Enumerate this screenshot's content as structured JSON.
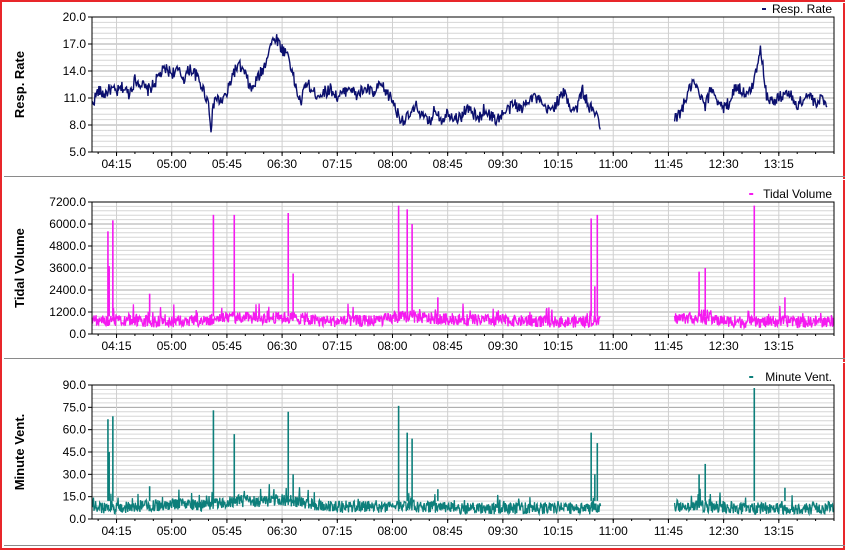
{
  "chart_data": [
    {
      "type": "line",
      "ylabel": "Resp. Rate",
      "legend": "Resp. Rate",
      "legend_position": "top-right",
      "color": "#0b0f6e",
      "ylim": [
        5.0,
        20.0
      ],
      "yticks": [
        "5.0",
        "8.0",
        "11.0",
        "14.0",
        "17.0",
        "20.0"
      ],
      "grid": true,
      "xlim": [
        "03:55",
        "14:00"
      ],
      "xticks": [
        "04:15",
        "05:00",
        "05:45",
        "06:30",
        "07:15",
        "08:00",
        "08:45",
        "09:30",
        "10:15",
        "11:00",
        "11:45",
        "12:30",
        "13:15"
      ],
      "gap": [
        "10:50",
        "11:50"
      ],
      "series": [
        {
          "values": [
            [
              "03:55",
              10.3
            ],
            [
              "04:00",
              11.8
            ],
            [
              "04:05",
              11.4
            ],
            [
              "04:10",
              12.0
            ],
            [
              "04:15",
              11.6
            ],
            [
              "04:20",
              12.2
            ],
            [
              "04:25",
              11.5
            ],
            [
              "04:30",
              13.0
            ],
            [
              "04:35",
              12.6
            ],
            [
              "04:40",
              11.8
            ],
            [
              "04:45",
              12.4
            ],
            [
              "04:50",
              13.6
            ],
            [
              "04:55",
              14.2
            ],
            [
              "05:00",
              13.8
            ],
            [
              "05:05",
              14.0
            ],
            [
              "05:10",
              13.2
            ],
            [
              "05:15",
              14.3
            ],
            [
              "05:20",
              13.5
            ],
            [
              "05:25",
              12.2
            ],
            [
              "05:30",
              10.5
            ],
            [
              "05:32",
              7.8
            ],
            [
              "05:35",
              11.0
            ],
            [
              "05:40",
              10.6
            ],
            [
              "05:45",
              11.4
            ],
            [
              "05:50",
              13.8
            ],
            [
              "05:55",
              14.6
            ],
            [
              "06:00",
              13.6
            ],
            [
              "06:05",
              11.8
            ],
            [
              "06:10",
              13.2
            ],
            [
              "06:15",
              14.3
            ],
            [
              "06:20",
              16.8
            ],
            [
              "06:25",
              17.8
            ],
            [
              "06:30",
              16.4
            ],
            [
              "06:35",
              15.9
            ],
            [
              "06:40",
              12.8
            ],
            [
              "06:45",
              10.4
            ],
            [
              "06:50",
              12.8
            ],
            [
              "06:55",
              11.6
            ],
            [
              "07:00",
              11.4
            ],
            [
              "07:05",
              11.7
            ],
            [
              "07:10",
              12.0
            ],
            [
              "07:15",
              11.1
            ],
            [
              "07:20",
              11.5
            ],
            [
              "07:25",
              12.4
            ],
            [
              "07:30",
              11.2
            ],
            [
              "07:35",
              11.8
            ],
            [
              "07:40",
              12.0
            ],
            [
              "07:45",
              11.4
            ],
            [
              "07:50",
              12.5
            ],
            [
              "07:55",
              11.6
            ],
            [
              "08:00",
              10.8
            ],
            [
              "08:05",
              9.0
            ],
            [
              "08:10",
              8.5
            ],
            [
              "08:15",
              9.2
            ],
            [
              "08:20",
              10.1
            ],
            [
              "08:25",
              8.8
            ],
            [
              "08:30",
              8.3
            ],
            [
              "08:35",
              9.8
            ],
            [
              "08:40",
              8.6
            ],
            [
              "08:45",
              9.4
            ],
            [
              "08:50",
              9.0
            ],
            [
              "08:55",
              8.7
            ],
            [
              "09:00",
              9.9
            ],
            [
              "09:05",
              9.4
            ],
            [
              "09:10",
              8.6
            ],
            [
              "09:15",
              9.8
            ],
            [
              "09:20",
              9.0
            ],
            [
              "09:25",
              8.6
            ],
            [
              "09:30",
              9.2
            ],
            [
              "09:35",
              9.8
            ],
            [
              "09:40",
              10.4
            ],
            [
              "09:45",
              9.6
            ],
            [
              "09:50",
              10.9
            ],
            [
              "09:55",
              11.2
            ],
            [
              "10:00",
              10.6
            ],
            [
              "10:05",
              9.6
            ],
            [
              "10:10",
              9.8
            ],
            [
              "10:15",
              10.7
            ],
            [
              "10:20",
              11.6
            ],
            [
              "10:25",
              10.0
            ],
            [
              "10:30",
              9.8
            ],
            [
              "10:35",
              11.9
            ],
            [
              "10:40",
              10.0
            ],
            [
              "10:45",
              9.4
            ],
            [
              "10:50",
              8.0
            ],
            [
              "11:50",
              8.5
            ],
            [
              "11:55",
              9.4
            ],
            [
              "12:00",
              11.2
            ],
            [
              "12:05",
              12.8
            ],
            [
              "12:10",
              11.4
            ],
            [
              "12:15",
              10.0
            ],
            [
              "12:20",
              12.2
            ],
            [
              "12:25",
              10.8
            ],
            [
              "12:30",
              9.8
            ],
            [
              "12:35",
              10.6
            ],
            [
              "12:40",
              12.4
            ],
            [
              "12:45",
              11.8
            ],
            [
              "12:50",
              11.2
            ],
            [
              "12:55",
              13.0
            ],
            [
              "13:00",
              16.8
            ],
            [
              "13:02",
              14.4
            ],
            [
              "13:05",
              11.4
            ],
            [
              "13:10",
              10.5
            ],
            [
              "13:15",
              11.0
            ],
            [
              "13:20",
              11.6
            ],
            [
              "13:25",
              11.2
            ],
            [
              "13:30",
              10.2
            ],
            [
              "13:35",
              10.9
            ],
            [
              "13:40",
              11.4
            ],
            [
              "13:45",
              10.1
            ],
            [
              "13:50",
              11.0
            ],
            [
              "13:55",
              10.4
            ]
          ]
        }
      ]
    },
    {
      "type": "line",
      "ylabel": "Tidal Volume",
      "legend": "Tidal Volume",
      "legend_position": "top-right",
      "color": "#f51af0",
      "ylim": [
        0.0,
        7200.0
      ],
      "yticks": [
        "0.0",
        "1200.0",
        "2400.0",
        "3600.0",
        "4800.0",
        "6000.0",
        "7200.0"
      ],
      "grid": true,
      "xlim": [
        "03:55",
        "14:00"
      ],
      "xticks": [
        "04:15",
        "05:00",
        "05:45",
        "06:30",
        "07:15",
        "08:00",
        "08:45",
        "09:30",
        "10:15",
        "11:00",
        "11:45",
        "12:30",
        "13:15"
      ],
      "gap": [
        "10:50",
        "11:50"
      ],
      "baseline": [
        [
          "03:55",
          700
        ],
        [
          "04:10",
          600
        ],
        [
          "04:25",
          650
        ],
        [
          "04:40",
          600
        ],
        [
          "04:55",
          550
        ],
        [
          "05:10",
          620
        ],
        [
          "05:25",
          580
        ],
        [
          "05:40",
          800
        ],
        [
          "05:55",
          820
        ],
        [
          "06:10",
          750
        ],
        [
          "06:25",
          800
        ],
        [
          "06:40",
          780
        ],
        [
          "06:55",
          650
        ],
        [
          "07:10",
          600
        ],
        [
          "07:25",
          620
        ],
        [
          "07:40",
          620
        ],
        [
          "07:55",
          700
        ],
        [
          "08:10",
          850
        ],
        [
          "08:25",
          780
        ],
        [
          "08:40",
          720
        ],
        [
          "08:55",
          700
        ],
        [
          "09:10",
          650
        ],
        [
          "09:25",
          660
        ],
        [
          "09:40",
          620
        ],
        [
          "09:55",
          600
        ],
        [
          "10:10",
          580
        ],
        [
          "10:25",
          560
        ],
        [
          "10:40",
          600
        ],
        [
          "10:50",
          600
        ],
        [
          "11:50",
          750
        ],
        [
          "12:05",
          800
        ],
        [
          "12:20",
          700
        ],
        [
          "12:35",
          600
        ],
        [
          "12:50",
          550
        ],
        [
          "13:05",
          550
        ],
        [
          "13:20",
          600
        ],
        [
          "13:35",
          560
        ],
        [
          "13:50",
          580
        ],
        [
          "14:00",
          560
        ]
      ],
      "spikes": [
        [
          "04:08",
          5600
        ],
        [
          "04:09",
          3700
        ],
        [
          "04:12",
          6200
        ],
        [
          "04:42",
          2200
        ],
        [
          "05:34",
          6500
        ],
        [
          "05:51",
          6500
        ],
        [
          "06:35",
          6600
        ],
        [
          "06:39",
          3300
        ],
        [
          "08:05",
          7000
        ],
        [
          "08:12",
          6800
        ],
        [
          "08:16",
          6000
        ],
        [
          "08:37",
          2000
        ],
        [
          "10:42",
          6300
        ],
        [
          "10:45",
          2600
        ],
        [
          "10:47",
          6500
        ],
        [
          "12:10",
          3400
        ],
        [
          "12:15",
          3600
        ],
        [
          "12:55",
          7000
        ],
        [
          "13:20",
          2000
        ]
      ]
    },
    {
      "type": "line",
      "ylabel": "Minute Vent.",
      "legend": "Minute Vent.",
      "legend_position": "top-right",
      "color": "#0d7f7b",
      "ylim": [
        0.0,
        90.0
      ],
      "yticks": [
        "0.0",
        "15.0",
        "30.0",
        "45.0",
        "60.0",
        "75.0",
        "90.0"
      ],
      "grid": true,
      "xlim": [
        "03:55",
        "14:00"
      ],
      "xticks": [
        "04:15",
        "05:00",
        "05:45",
        "06:30",
        "07:15",
        "08:00",
        "08:45",
        "09:30",
        "10:15",
        "11:00",
        "11:45",
        "12:30",
        "13:15"
      ],
      "gap": [
        "10:50",
        "11:50"
      ],
      "baseline": [
        [
          "03:55",
          7
        ],
        [
          "04:10",
          6
        ],
        [
          "04:25",
          7
        ],
        [
          "04:40",
          8
        ],
        [
          "04:55",
          8
        ],
        [
          "05:10",
          9
        ],
        [
          "05:25",
          8
        ],
        [
          "05:40",
          10
        ],
        [
          "05:55",
          11
        ],
        [
          "06:10",
          10
        ],
        [
          "06:25",
          12
        ],
        [
          "06:40",
          11
        ],
        [
          "06:55",
          8
        ],
        [
          "07:10",
          7
        ],
        [
          "07:25",
          7
        ],
        [
          "07:40",
          7
        ],
        [
          "07:55",
          7
        ],
        [
          "08:10",
          8
        ],
        [
          "08:25",
          7
        ],
        [
          "08:40",
          7
        ],
        [
          "08:55",
          6
        ],
        [
          "09:10",
          6
        ],
        [
          "09:25",
          6
        ],
        [
          "09:40",
          6
        ],
        [
          "09:55",
          6
        ],
        [
          "10:10",
          6
        ],
        [
          "10:25",
          6
        ],
        [
          "10:40",
          6
        ],
        [
          "10:50",
          6
        ],
        [
          "11:50",
          7
        ],
        [
          "12:05",
          8
        ],
        [
          "12:20",
          7
        ],
        [
          "12:35",
          6
        ],
        [
          "12:50",
          6
        ],
        [
          "13:05",
          6
        ],
        [
          "13:20",
          6
        ],
        [
          "13:35",
          6
        ],
        [
          "13:50",
          6
        ],
        [
          "14:00",
          6
        ]
      ],
      "spikes": [
        [
          "04:08",
          67
        ],
        [
          "04:09",
          45
        ],
        [
          "04:12",
          69
        ],
        [
          "04:42",
          22
        ],
        [
          "05:34",
          73
        ],
        [
          "05:51",
          57
        ],
        [
          "06:35",
          72
        ],
        [
          "06:39",
          30
        ],
        [
          "08:05",
          76
        ],
        [
          "08:12",
          58
        ],
        [
          "08:16",
          54
        ],
        [
          "08:37",
          20
        ],
        [
          "10:42",
          58
        ],
        [
          "10:45",
          30
        ],
        [
          "10:47",
          51
        ],
        [
          "12:10",
          30
        ],
        [
          "12:15",
          37
        ],
        [
          "12:55",
          88
        ],
        [
          "13:20",
          21
        ]
      ]
    }
  ]
}
